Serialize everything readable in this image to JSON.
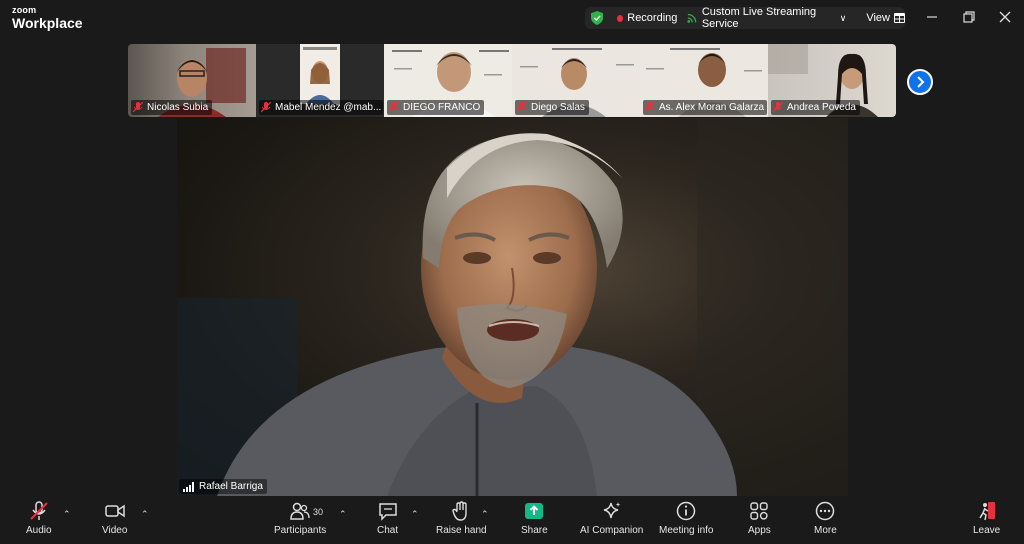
{
  "app": {
    "logo_small": "zoom",
    "logo_large": "Workplace"
  },
  "header": {
    "recording_label": "Recording",
    "stream_label": "Custom Live Streaming Service",
    "view_label": "View"
  },
  "thumbnails": [
    {
      "name": "Nicolas Subia"
    },
    {
      "name": "Mabel Mendez @mab..."
    },
    {
      "name": "DIEGO FRANCO"
    },
    {
      "name": "Diego Salas"
    },
    {
      "name": "As. Alex Moran Galarza"
    },
    {
      "name": "Andrea Poveda"
    }
  ],
  "main": {
    "speaker_name": "Rafael Barriga"
  },
  "toolbar": {
    "audio": "Audio",
    "video": "Video",
    "participants": "Participants",
    "participants_count": "30",
    "chat": "Chat",
    "raise_hand": "Raise hand",
    "share": "Share",
    "ai_companion": "AI Companion",
    "meeting_info": "Meeting info",
    "apps": "Apps",
    "more": "More",
    "leave": "Leave"
  },
  "colors": {
    "accent": "#0e72ed",
    "share_green": "#12b886",
    "record_red": "#e5323b",
    "shield_green": "#2fb24c"
  }
}
